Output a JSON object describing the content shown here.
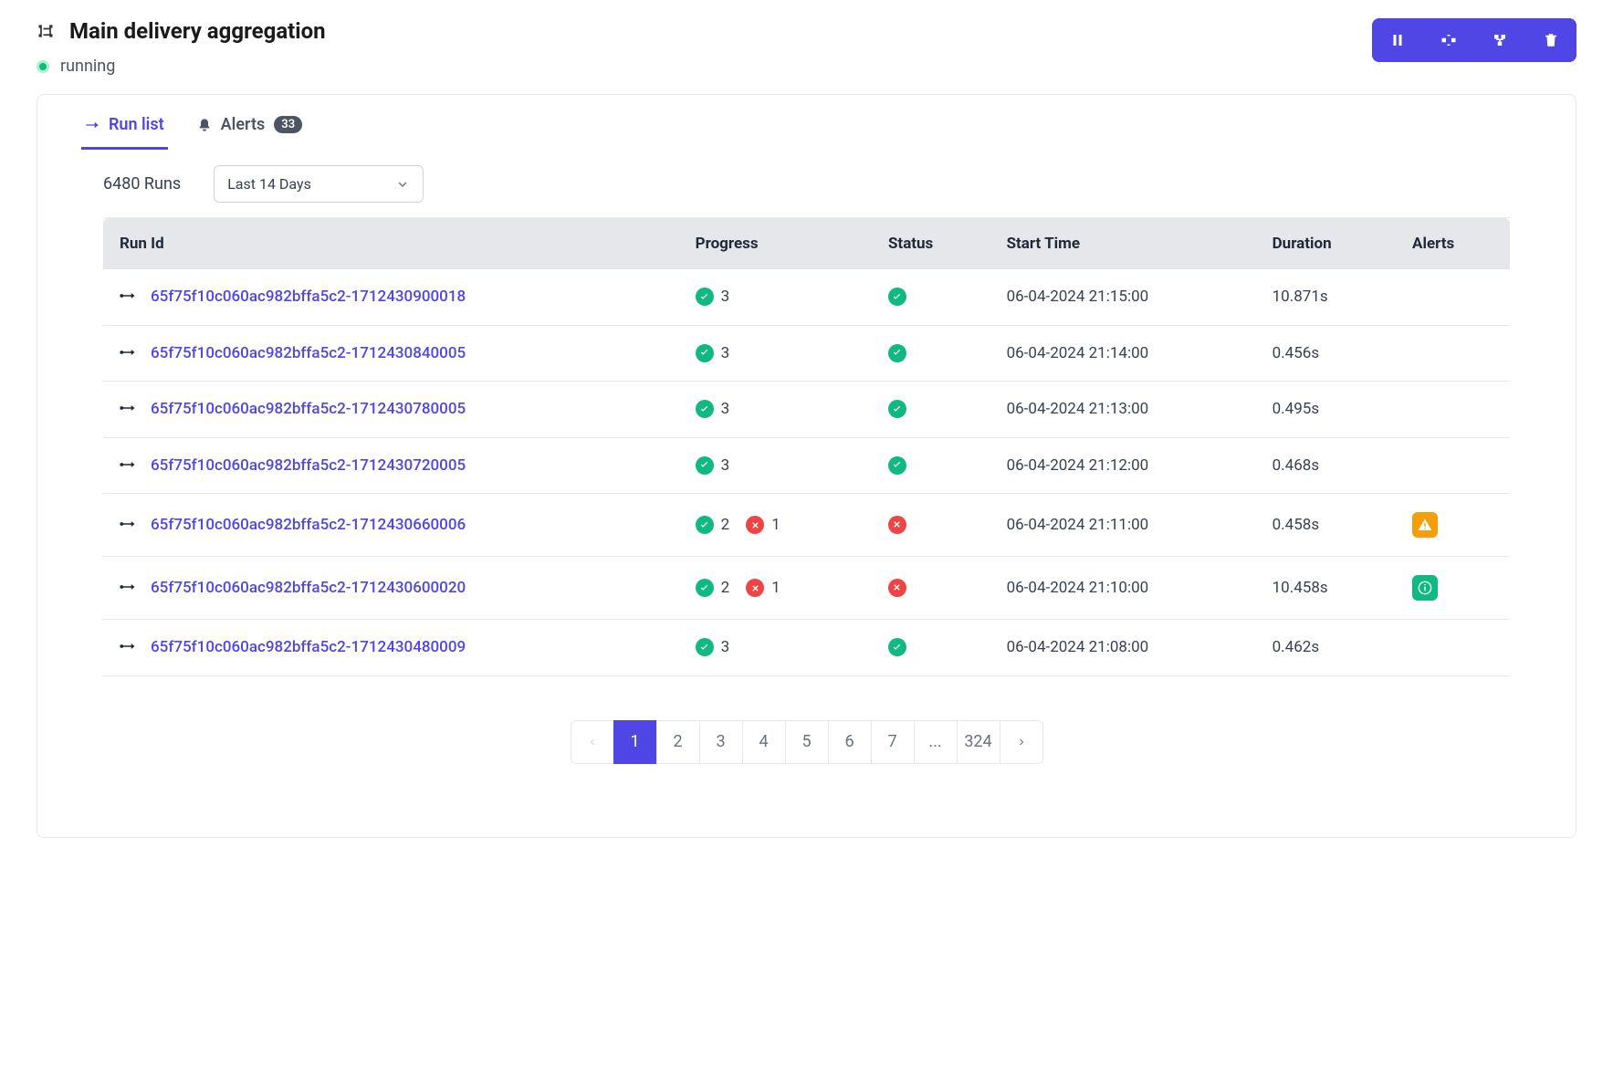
{
  "header": {
    "title": "Main delivery aggregation",
    "status": "running"
  },
  "tabs": {
    "run_list": "Run list",
    "alerts": "Alerts",
    "alerts_badge": "33"
  },
  "controls": {
    "runs_count": "6480 Runs",
    "date_range": "Last 14 Days"
  },
  "table": {
    "headers": {
      "run_id": "Run Id",
      "progress": "Progress",
      "status": "Status",
      "start_time": "Start Time",
      "duration": "Duration",
      "alerts": "Alerts"
    },
    "rows": [
      {
        "id": "65f75f10c060ac982bffa5c2-1712430900018",
        "ok": "3",
        "fail": "",
        "status": "ok",
        "start": "06-04-2024 21:15:00",
        "duration": "10.871s",
        "alert": ""
      },
      {
        "id": "65f75f10c060ac982bffa5c2-1712430840005",
        "ok": "3",
        "fail": "",
        "status": "ok",
        "start": "06-04-2024 21:14:00",
        "duration": "0.456s",
        "alert": ""
      },
      {
        "id": "65f75f10c060ac982bffa5c2-1712430780005",
        "ok": "3",
        "fail": "",
        "status": "ok",
        "start": "06-04-2024 21:13:00",
        "duration": "0.495s",
        "alert": ""
      },
      {
        "id": "65f75f10c060ac982bffa5c2-1712430720005",
        "ok": "3",
        "fail": "",
        "status": "ok",
        "start": "06-04-2024 21:12:00",
        "duration": "0.468s",
        "alert": ""
      },
      {
        "id": "65f75f10c060ac982bffa5c2-1712430660006",
        "ok": "2",
        "fail": "1",
        "status": "fail",
        "start": "06-04-2024 21:11:00",
        "duration": "0.458s",
        "alert": "warn"
      },
      {
        "id": "65f75f10c060ac982bffa5c2-1712430600020",
        "ok": "2",
        "fail": "1",
        "status": "fail",
        "start": "06-04-2024 21:10:00",
        "duration": "10.458s",
        "alert": "info"
      },
      {
        "id": "65f75f10c060ac982bffa5c2-1712430480009",
        "ok": "3",
        "fail": "",
        "status": "ok",
        "start": "06-04-2024 21:08:00",
        "duration": "0.462s",
        "alert": ""
      }
    ]
  },
  "pagination": {
    "pages": [
      "1",
      "2",
      "3",
      "4",
      "5",
      "6",
      "7"
    ],
    "ellipsis": "...",
    "last": "324",
    "active": "1"
  }
}
